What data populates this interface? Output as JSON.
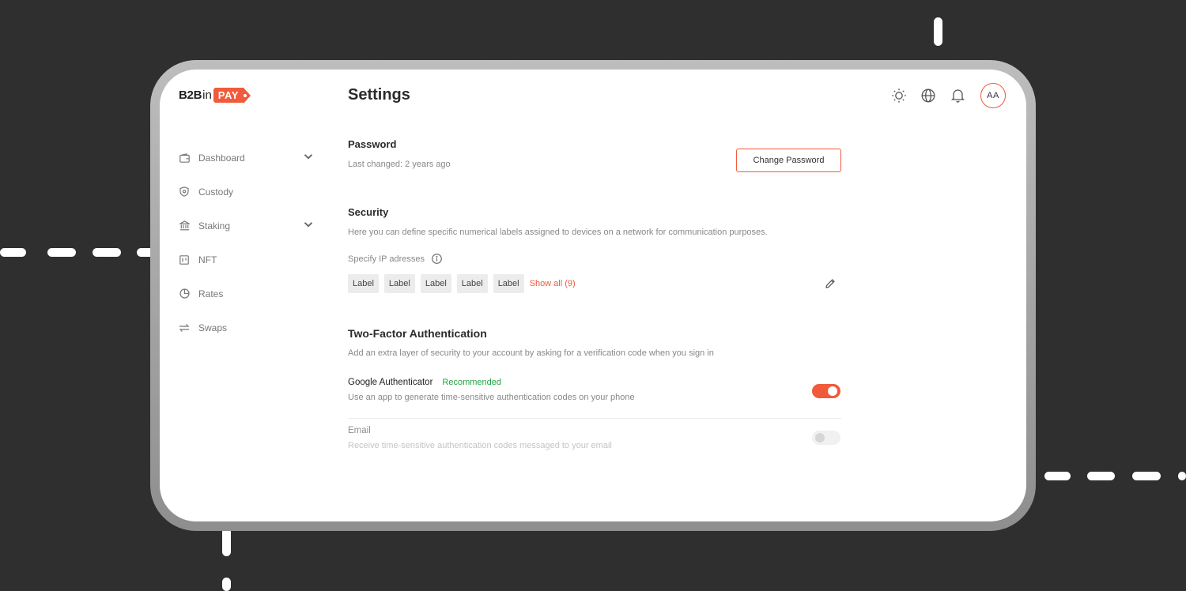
{
  "logo": {
    "part1": "B2B",
    "part2": "in",
    "part3": "PAY"
  },
  "page_title": "Settings",
  "sidebar": {
    "items": [
      {
        "label": "Dashboard"
      },
      {
        "label": "Custody"
      },
      {
        "label": "Staking"
      },
      {
        "label": "NFT"
      },
      {
        "label": "Rates"
      },
      {
        "label": "Swaps"
      }
    ]
  },
  "header": {
    "avatar_initials": "AA"
  },
  "password": {
    "title": "Password",
    "last_changed": "Last changed: 2 years ago",
    "button_label": "Change Password"
  },
  "security": {
    "title": "Security",
    "description": "Here you can define specific numerical labels assigned to devices on a network for communication purposes.",
    "ip_label": "Specify IP adresses",
    "labels": [
      "Label",
      "Label",
      "Label",
      "Label",
      "Label"
    ],
    "show_all": "Show all (9)"
  },
  "two_factor": {
    "title": "Two-Factor Authentication",
    "description": "Add an extra layer of security to your account by asking for a verification code when you sign in",
    "google": {
      "title": "Google Authenticator",
      "badge": "Recommended",
      "description": "Use an app to generate time-sensitive authentication codes on your phone",
      "enabled": true
    },
    "email": {
      "title": "Email",
      "description": "Receive time-sensitive authentication codes messaged to your email",
      "enabled": false
    }
  },
  "colors": {
    "accent": "#f15a3b",
    "recommended": "#22a345",
    "background": "#2f2f2f"
  }
}
